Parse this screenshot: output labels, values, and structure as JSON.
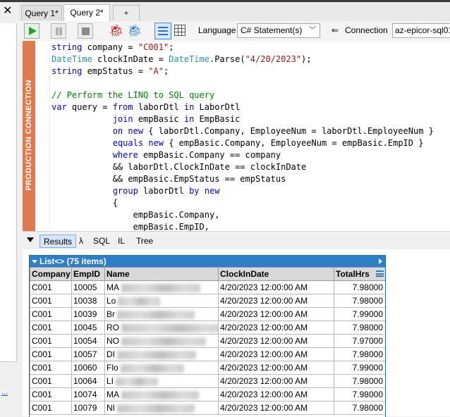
{
  "window": {
    "close_glyph": "✕"
  },
  "tabs": [
    {
      "label": "Query 1*"
    },
    {
      "label": "Query 2*"
    },
    {
      "label": "+"
    }
  ],
  "toolbar": {
    "language_label": "Language",
    "language_value": "C# Statement(s)",
    "connection_icon": "⇐",
    "connection_label": "Connection",
    "connection_value": "az-epicor-sql01"
  },
  "editor": {
    "banner": "PRODUCTION CONNECTION",
    "colors": {
      "banner": "#df7a4e",
      "keyword": "#0000ee",
      "string": "#a31515",
      "type": "#2b91af",
      "comment": "#008000"
    },
    "lines": [
      [
        {
          "t": "kw",
          "v": "string"
        },
        {
          "t": "plain",
          "v": " company = "
        },
        {
          "t": "str",
          "v": "\"C001\""
        },
        {
          "t": "plain",
          "v": ";"
        }
      ],
      [
        {
          "t": "typ",
          "v": "DateTime"
        },
        {
          "t": "plain",
          "v": " clockInDate = "
        },
        {
          "t": "typ",
          "v": "DateTime"
        },
        {
          "t": "plain",
          "v": ".Parse("
        },
        {
          "t": "str",
          "v": "\"4/20/2023\""
        },
        {
          "t": "plain",
          "v": ");"
        }
      ],
      [
        {
          "t": "kw",
          "v": "string"
        },
        {
          "t": "plain",
          "v": " empStatus = "
        },
        {
          "t": "str",
          "v": "\"A\""
        },
        {
          "t": "plain",
          "v": ";"
        }
      ],
      [],
      [
        {
          "t": "cmt",
          "v": "// Perform the LINQ to SQL query"
        }
      ],
      [
        {
          "t": "kw",
          "v": "var"
        },
        {
          "t": "plain",
          "v": " query = "
        },
        {
          "t": "kw",
          "v": "from"
        },
        {
          "t": "plain",
          "v": " laborDtl "
        },
        {
          "t": "kw",
          "v": "in"
        },
        {
          "t": "plain",
          "v": " LaborDtl"
        }
      ],
      [
        {
          "t": "plain",
          "v": "            "
        },
        {
          "t": "kw",
          "v": "join"
        },
        {
          "t": "plain",
          "v": " empBasic "
        },
        {
          "t": "kw",
          "v": "in"
        },
        {
          "t": "plain",
          "v": " EmpBasic"
        }
      ],
      [
        {
          "t": "plain",
          "v": "            "
        },
        {
          "t": "kw",
          "v": "on"
        },
        {
          "t": "plain",
          "v": " "
        },
        {
          "t": "kw",
          "v": "new"
        },
        {
          "t": "plain",
          "v": " { laborDtl.Company, EmployeeNum = laborDtl.EmployeeNum }"
        }
      ],
      [
        {
          "t": "plain",
          "v": "            "
        },
        {
          "t": "kw",
          "v": "equals"
        },
        {
          "t": "plain",
          "v": " "
        },
        {
          "t": "kw",
          "v": "new"
        },
        {
          "t": "plain",
          "v": " { empBasic.Company, EmployeeNum = empBasic.EmpID }"
        }
      ],
      [
        {
          "t": "plain",
          "v": "            "
        },
        {
          "t": "kw",
          "v": "where"
        },
        {
          "t": "plain",
          "v": " empBasic.Company == company"
        }
      ],
      [
        {
          "t": "plain",
          "v": "            && laborDtl.ClockInDate == clockInDate"
        }
      ],
      [
        {
          "t": "plain",
          "v": "            && empBasic.EmpStatus == empStatus"
        }
      ],
      [
        {
          "t": "plain",
          "v": "            "
        },
        {
          "t": "kw",
          "v": "group"
        },
        {
          "t": "plain",
          "v": " laborDtl "
        },
        {
          "t": "kw",
          "v": "by"
        },
        {
          "t": "plain",
          "v": " "
        },
        {
          "t": "kw",
          "v": "new"
        }
      ],
      [
        {
          "t": "plain",
          "v": "            {"
        }
      ],
      [
        {
          "t": "plain",
          "v": "                empBasic.Company,"
        }
      ],
      [
        {
          "t": "plain",
          "v": "                empBasic.EmpID,"
        }
      ]
    ]
  },
  "results_tabs": [
    {
      "label": "Results"
    },
    {
      "label": "λ"
    },
    {
      "label": "SQL"
    },
    {
      "label": "IL"
    },
    {
      "label": "Tree"
    }
  ],
  "results": {
    "header": "List<> (75 items)",
    "columns": [
      "Company",
      "EmpID",
      "Name",
      "ClockInDate",
      "TotalHrs"
    ],
    "rows": [
      {
        "company": "C001",
        "empid": "10005",
        "name": "MA",
        "clock": "4/20/2023 12:00:00 AM",
        "hrs": "7.98000"
      },
      {
        "company": "C001",
        "empid": "10038",
        "name": "Lo",
        "clock": "4/20/2023 12:00:00 AM",
        "hrs": "7.98000"
      },
      {
        "company": "C001",
        "empid": "10039",
        "name": "Br",
        "clock": "4/20/2023 12:00:00 AM",
        "hrs": "7.99000"
      },
      {
        "company": "C001",
        "empid": "10045",
        "name": "RO",
        "clock": "4/20/2023 12:00:00 AM",
        "hrs": "7.98000"
      },
      {
        "company": "C001",
        "empid": "10054",
        "name": "NO",
        "clock": "4/20/2023 12:00:00 AM",
        "hrs": "7.97000"
      },
      {
        "company": "C001",
        "empid": "10057",
        "name": "DI",
        "clock": "4/20/2023 12:00:00 AM",
        "hrs": "7.98000"
      },
      {
        "company": "C001",
        "empid": "10060",
        "name": "Flo",
        "clock": "4/20/2023 12:00:00 AM",
        "hrs": "7.99000"
      },
      {
        "company": "C001",
        "empid": "10064",
        "name": "LI",
        "clock": "4/20/2023 12:00:00 AM",
        "hrs": "7.98000"
      },
      {
        "company": "C001",
        "empid": "10074",
        "name": "MA",
        "clock": "4/20/2023 12:00:00 AM",
        "hrs": "7.98000"
      },
      {
        "company": "C001",
        "empid": "10079",
        "name": "NI",
        "clock": "4/20/2023 12:00:00 AM",
        "hrs": "7.98000"
      }
    ]
  },
  "left_pane": {
    "link": "..."
  }
}
